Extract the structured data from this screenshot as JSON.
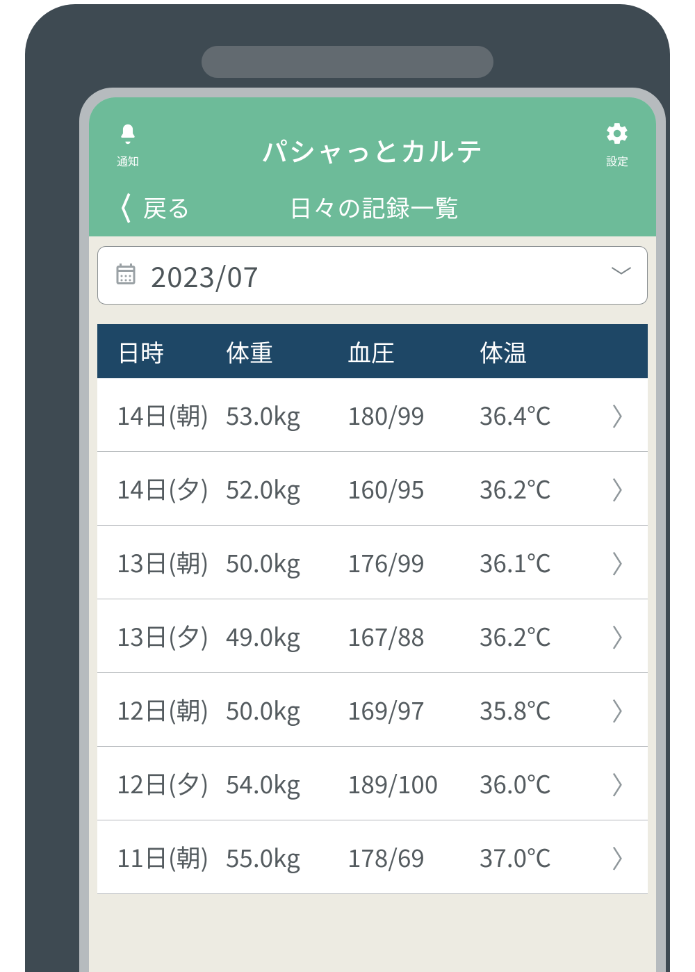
{
  "header": {
    "app_title": "パシャっとカルテ",
    "notify_label": "通知",
    "settings_label": "設定",
    "back_label": "戻る",
    "subtitle": "日々の記録一覧"
  },
  "date_picker": {
    "value": "2023/07"
  },
  "table": {
    "headers": {
      "date": "日時",
      "weight": "体重",
      "bp": "血圧",
      "temp": "体温"
    },
    "rows": [
      {
        "date": "14日(朝)",
        "weight": "53.0kg",
        "bp": "180/99",
        "temp": "36.4℃"
      },
      {
        "date": "14日(夕)",
        "weight": "52.0kg",
        "bp": "160/95",
        "temp": "36.2℃"
      },
      {
        "date": "13日(朝)",
        "weight": "50.0kg",
        "bp": "176/99",
        "temp": "36.1℃"
      },
      {
        "date": "13日(夕)",
        "weight": "49.0kg",
        "bp": "167/88",
        "temp": "36.2℃"
      },
      {
        "date": "12日(朝)",
        "weight": "50.0kg",
        "bp": "169/97",
        "temp": "35.8℃"
      },
      {
        "date": "12日(夕)",
        "weight": "54.0kg",
        "bp": "189/100",
        "temp": "36.0℃"
      },
      {
        "date": "11日(朝)",
        "weight": "55.0kg",
        "bp": "178/69",
        "temp": "37.0℃"
      }
    ]
  }
}
